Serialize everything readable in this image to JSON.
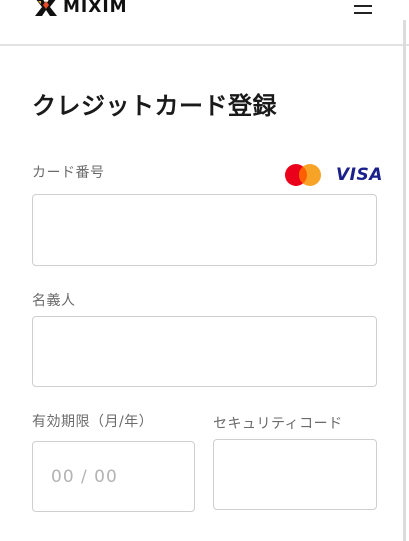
{
  "header": {
    "logo_text": "MIXIM"
  },
  "title": "クレジットカード登録",
  "card_number": {
    "label": "カード番号",
    "value": "",
    "placeholder": ""
  },
  "brands": {
    "mastercard": "mastercard-logo",
    "visa": "VISA"
  },
  "cardholder": {
    "label": "名義人",
    "value": "",
    "placeholder": ""
  },
  "expiry": {
    "label": "有効期限（月/年）",
    "value": "",
    "placeholder": "00 / 00"
  },
  "security_code": {
    "label": "セキュリティコード",
    "value": "",
    "placeholder": ""
  },
  "colors": {
    "mastercard_red": "#eb001b",
    "mastercard_orange": "#f79e1b",
    "visa_blue": "#1a1f8c",
    "border": "#cfcfcf"
  }
}
